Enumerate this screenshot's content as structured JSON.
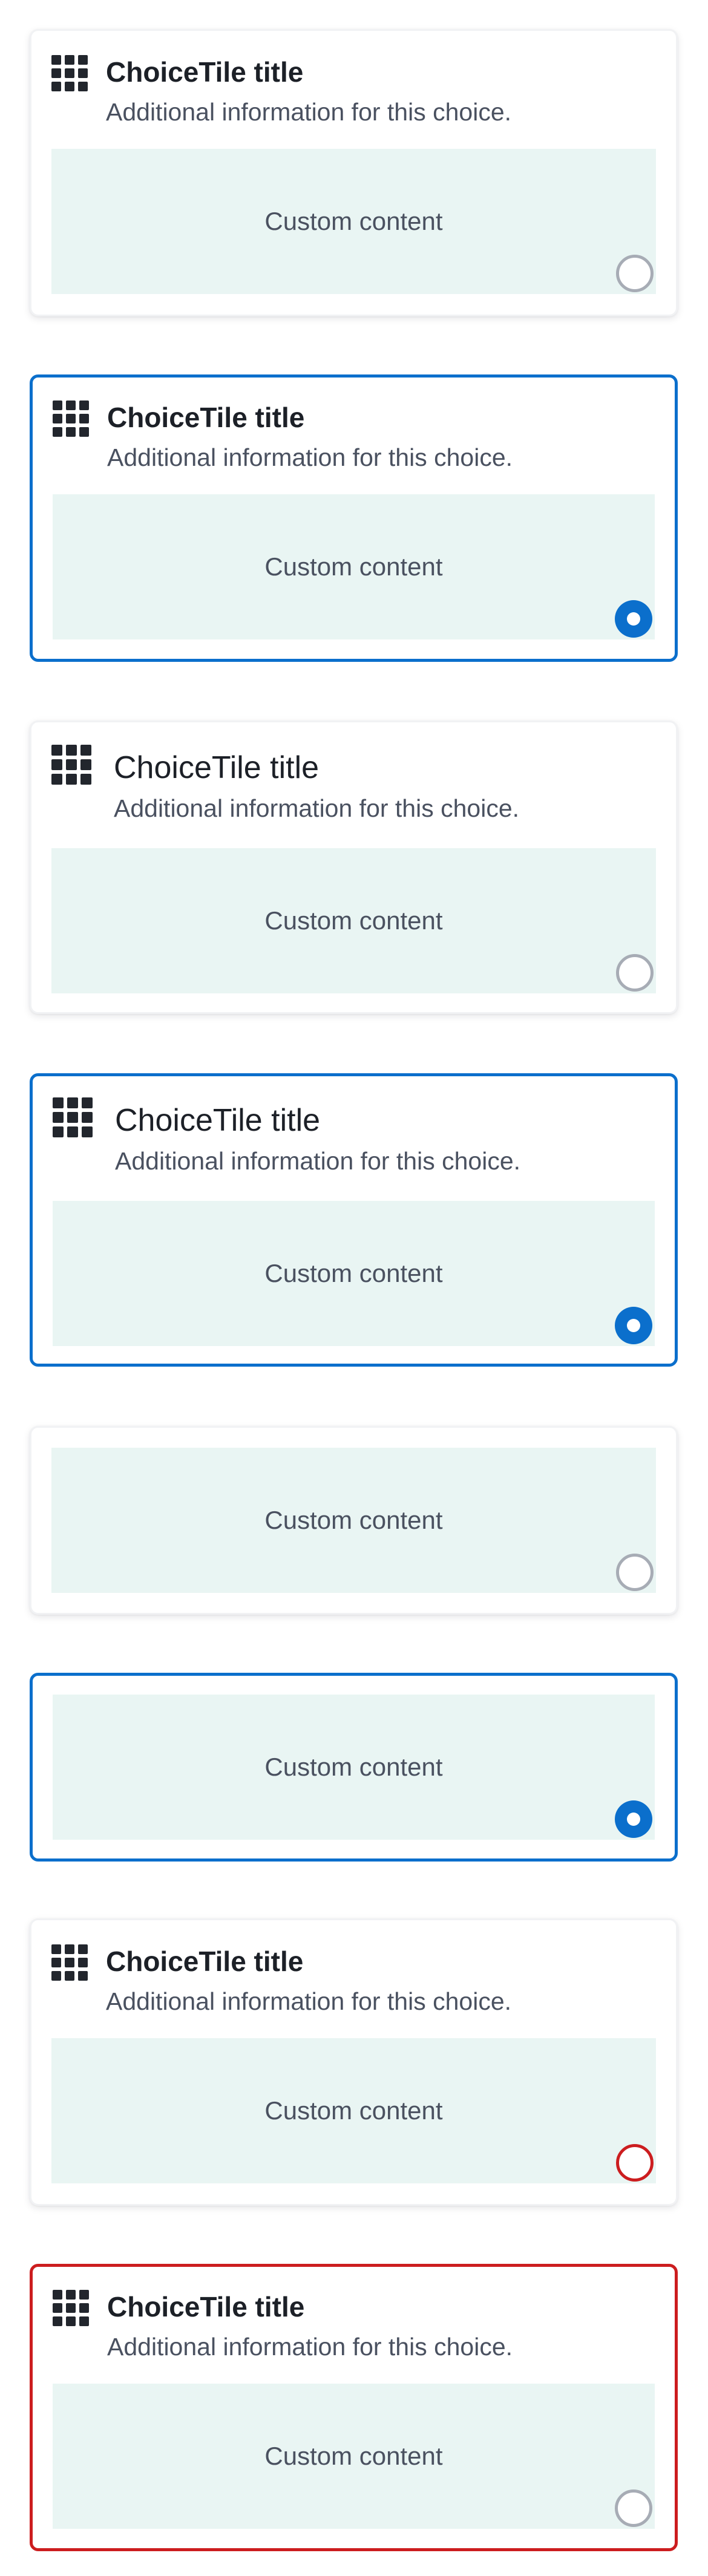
{
  "tiles": [
    {
      "title": "ChoiceTile title",
      "description": "Additional information for this choice.",
      "content": "Custom content",
      "state": "unselected"
    },
    {
      "title": "ChoiceTile title",
      "description": "Additional information for this choice.",
      "content": "Custom content",
      "state": "selected"
    },
    {
      "title": "ChoiceTile title",
      "description": "Additional information for this choice.",
      "content": "Custom content",
      "state": "unselected"
    },
    {
      "title": "ChoiceTile title",
      "description": "Additional information for this choice.",
      "content": "Custom content",
      "state": "selected"
    },
    {
      "content": "Custom content",
      "state": "unselected"
    },
    {
      "content": "Custom content",
      "state": "selected"
    },
    {
      "title": "ChoiceTile title",
      "description": "Additional information for this choice.",
      "content": "Custom content",
      "state": "unselected-invalid"
    },
    {
      "title": "ChoiceTile title",
      "description": "Additional information for this choice.",
      "content": "Custom content",
      "state": "invalid-tile"
    }
  ],
  "colors": {
    "selected_accent": "#0b6fcc",
    "error_accent": "#cc1d1f",
    "content_background": "#e9f5f3",
    "radio_unselected_border": "#a7acb5",
    "title_text": "#1c2027",
    "body_text": "#4a5160"
  }
}
